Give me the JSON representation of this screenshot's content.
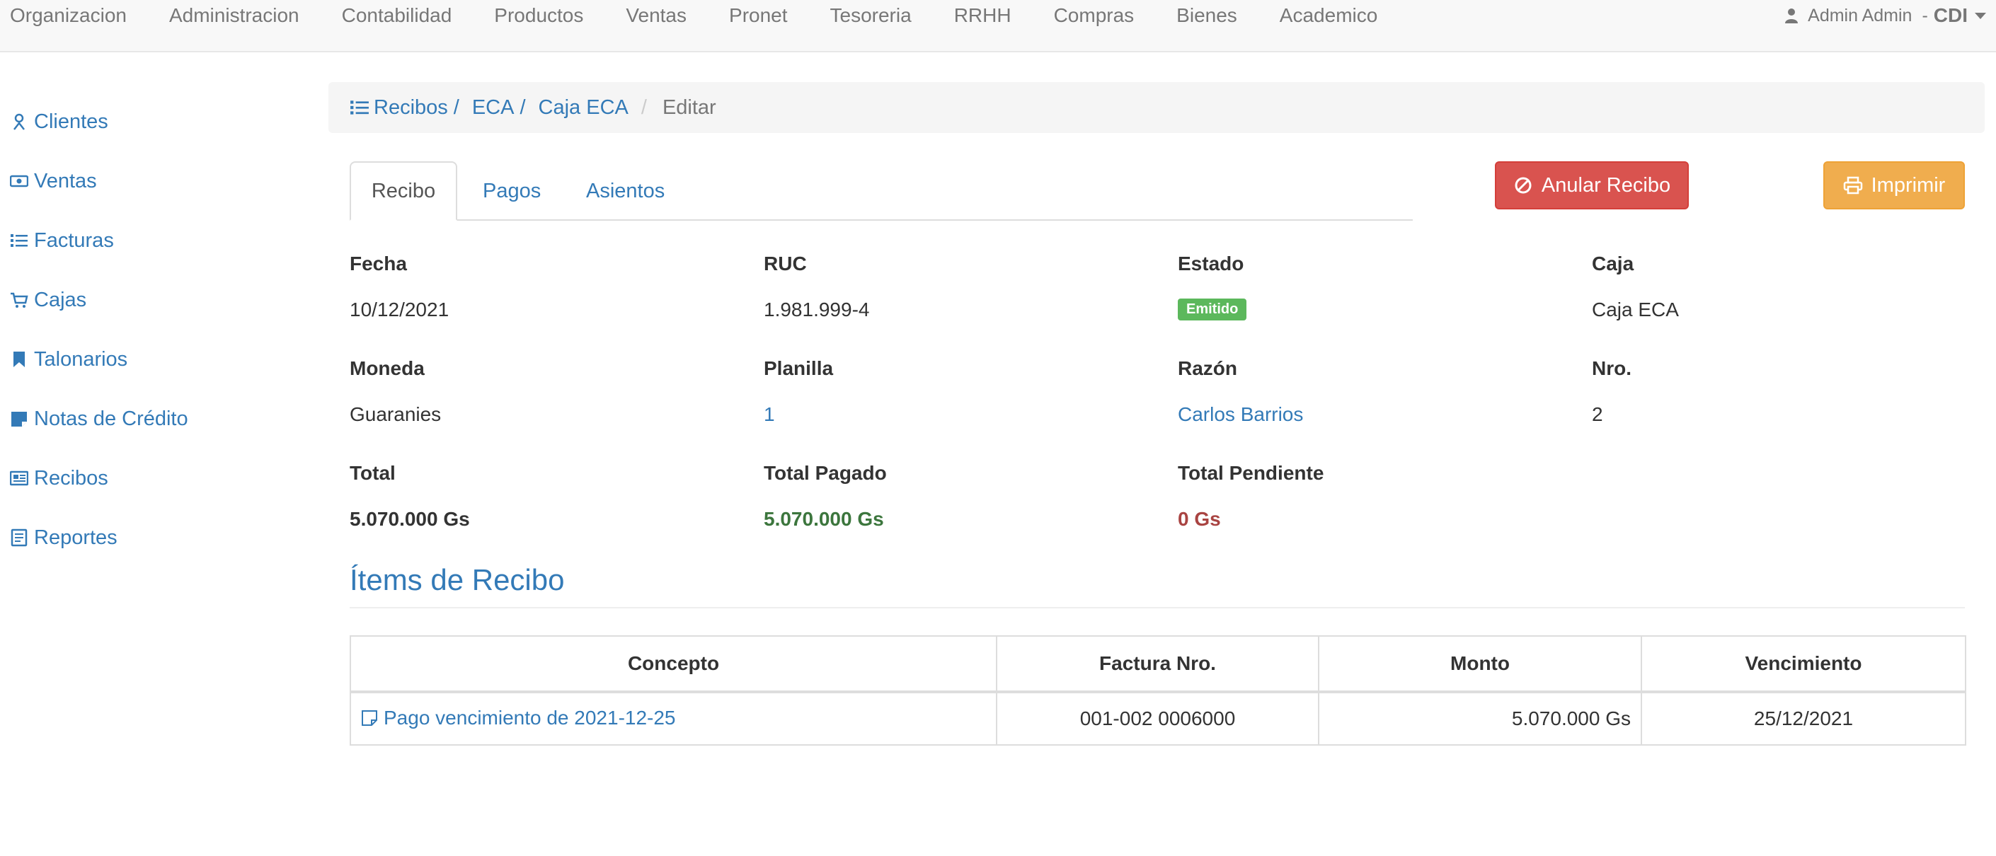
{
  "navbar": {
    "menu": [
      "Organizacion",
      "Administracion",
      "Contabilidad",
      "Productos",
      "Ventas",
      "Pronet",
      "Tesoreria",
      "RRHH",
      "Compras",
      "Bienes",
      "Academico"
    ],
    "user_name": "Admin Admin",
    "separator": "-",
    "organization": "CDI"
  },
  "sidebar": {
    "items": [
      {
        "label": "Clientes",
        "icon": "user-icon"
      },
      {
        "label": "Ventas",
        "icon": "money-icon"
      },
      {
        "label": "Facturas",
        "icon": "list-icon"
      },
      {
        "label": "Cajas",
        "icon": "cart-icon"
      },
      {
        "label": "Talonarios",
        "icon": "bookmark-icon"
      },
      {
        "label": "Notas de Crédito",
        "icon": "sticky-note-icon"
      },
      {
        "label": "Recibos",
        "icon": "newspaper-icon"
      },
      {
        "label": "Reportes",
        "icon": "report-icon"
      }
    ]
  },
  "breadcrumb": {
    "recibos": "Recibos",
    "eca": "ECA",
    "caja": "Caja ECA",
    "active": "Editar",
    "sep": "/"
  },
  "tabs": [
    "Recibo",
    "Pagos",
    "Asientos"
  ],
  "actions": {
    "anular_label": "Anular Recibo",
    "imprimir_label": "Imprimir"
  },
  "fields": {
    "fecha": {
      "label": "Fecha",
      "value": "10/12/2021"
    },
    "ruc": {
      "label": "RUC",
      "value": "1.981.999-4"
    },
    "estado": {
      "label": "Estado",
      "value": "Emitido"
    },
    "caja": {
      "label": "Caja",
      "value": "Caja ECA"
    },
    "moneda": {
      "label": "Moneda",
      "value": "Guaranies"
    },
    "planilla": {
      "label": "Planilla",
      "value": "1"
    },
    "razon": {
      "label": "Razón",
      "value": "Carlos Barrios"
    },
    "nro": {
      "label": "Nro.",
      "value": "2"
    },
    "total": {
      "label": "Total",
      "value": "5.070.000 Gs"
    },
    "total_pagado": {
      "label": "Total Pagado",
      "value": "5.070.000 Gs"
    },
    "total_pendiente": {
      "label": "Total Pendiente",
      "value": "0 Gs"
    }
  },
  "items_section": {
    "title": "Ítems de Recibo",
    "columns": [
      "Concepto",
      "Factura Nro.",
      "Monto",
      "Vencimiento"
    ],
    "rows": [
      {
        "concepto": "Pago vencimiento de 2021-12-25",
        "factura": "001-002 0006000",
        "monto": "5.070.000 Gs",
        "vencimiento": "25/12/2021"
      }
    ]
  },
  "colors": {
    "link": "#337ab7",
    "danger": "#d9534f",
    "warning": "#f0ad4e",
    "success": "#5cb85c",
    "paid": "#3c763d",
    "pending": "#a94442"
  }
}
